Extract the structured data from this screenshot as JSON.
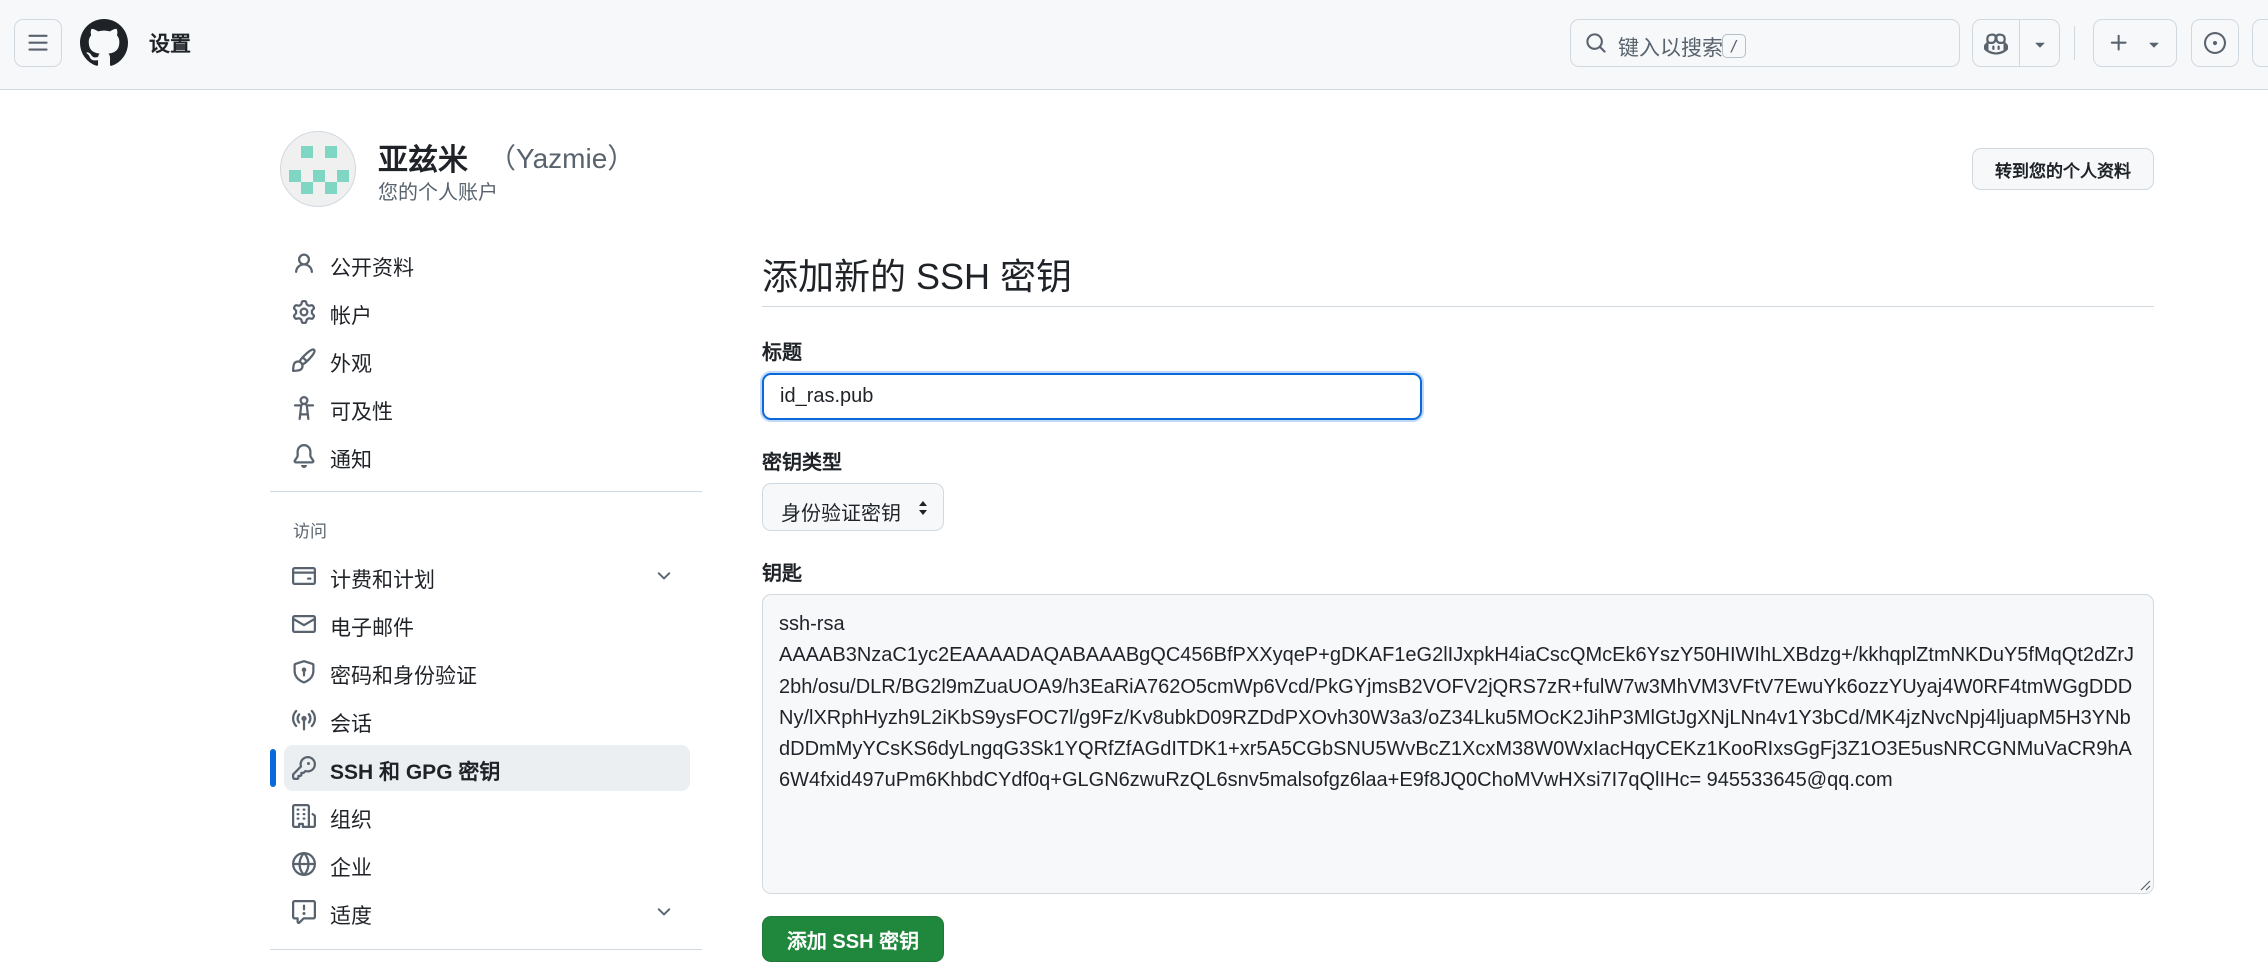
{
  "header": {
    "title": "设置",
    "search_placeholder": "键入以搜索",
    "search_shortcut": "/"
  },
  "profile": {
    "name": "亚兹米",
    "login": "（Yazmie）",
    "subtitle": "您的个人账户",
    "goto_label": "转到您的个人资料"
  },
  "sidebar": {
    "items": [
      {
        "label": "公开资料",
        "icon": "person-icon"
      },
      {
        "label": "帐户",
        "icon": "gear-icon"
      },
      {
        "label": "外观",
        "icon": "paintbrush-icon"
      },
      {
        "label": "可及性",
        "icon": "accessibility-icon"
      },
      {
        "label": "通知",
        "icon": "bell-icon"
      }
    ],
    "section_access": "访问",
    "access_items": [
      {
        "label": "计费和计划",
        "icon": "credit-card-icon",
        "expandable": true
      },
      {
        "label": "电子邮件",
        "icon": "mail-icon"
      },
      {
        "label": "密码和身份验证",
        "icon": "shield-lock-icon"
      },
      {
        "label": "会话",
        "icon": "broadcast-icon"
      },
      {
        "label": "SSH 和 GPG 密钥",
        "icon": "key-icon",
        "active": true
      },
      {
        "label": "组织",
        "icon": "organization-icon"
      },
      {
        "label": "企业",
        "icon": "globe-icon"
      },
      {
        "label": "适度",
        "icon": "report-icon",
        "expandable": true
      }
    ]
  },
  "main": {
    "title": "添加新的 SSH 密钥",
    "title_label": "标题",
    "title_value": "id_ras.pub",
    "key_type_label": "密钥类型",
    "key_type_value": "身份验证密钥",
    "key_label": "钥匙",
    "key_value": "ssh-rsa\nAAAAB3NzaC1yc2EAAAADAQABAAABgQC456BfPXXyqeP+gDKAF1eG2lIJxpkH4iaCscQMcEk6YszY50HIWIhLXBdzg+/kkhqplZtmNKDuY5fMqQt2dZrJ2bh/osu/DLR/BG2l9mZuaUOA9/h3EaRiA762O5cmWp6Vcd/PkGYjmsB2VOFV2jQRS7zR+fulW7w3MhVM3VFtV7EwuYk6ozzYUyaj4W0RF4tmWGgDDDNy/lXRphHyzh9L2iKbS9ysFOC7l/g9Fz/Kv8ubkD09RZDdPXOvh30W3a3/oZ34Lku5MOcK2JihP3MlGtJgXNjLNn4v1Y3bCd/MK4jzNvcNpj4ljuapM5H3YNbdDDmMyYCsKS6dyLngqG3Sk1YQRfZfAGdITDK1+xr5A5CGbSNU5WvBcZ1XcxM38W0WxIacHqyCEKz1KooRIxsGgFj3Z1O3E5usNRCGNMuVaCR9hA6W4fxid497uPm6KhbdCYdf0q+GLGN6zwuRzQL6snv5malsofgz6laa+E9f8JQ0ChoMVwHXsi7I7qQlIHc= 945533645@qq.com",
    "submit_label": "添加 SSH 密钥"
  },
  "colors": {
    "accent": "#0969da",
    "primary_button": "#1f883d",
    "avatar": "#7fd6c2"
  }
}
